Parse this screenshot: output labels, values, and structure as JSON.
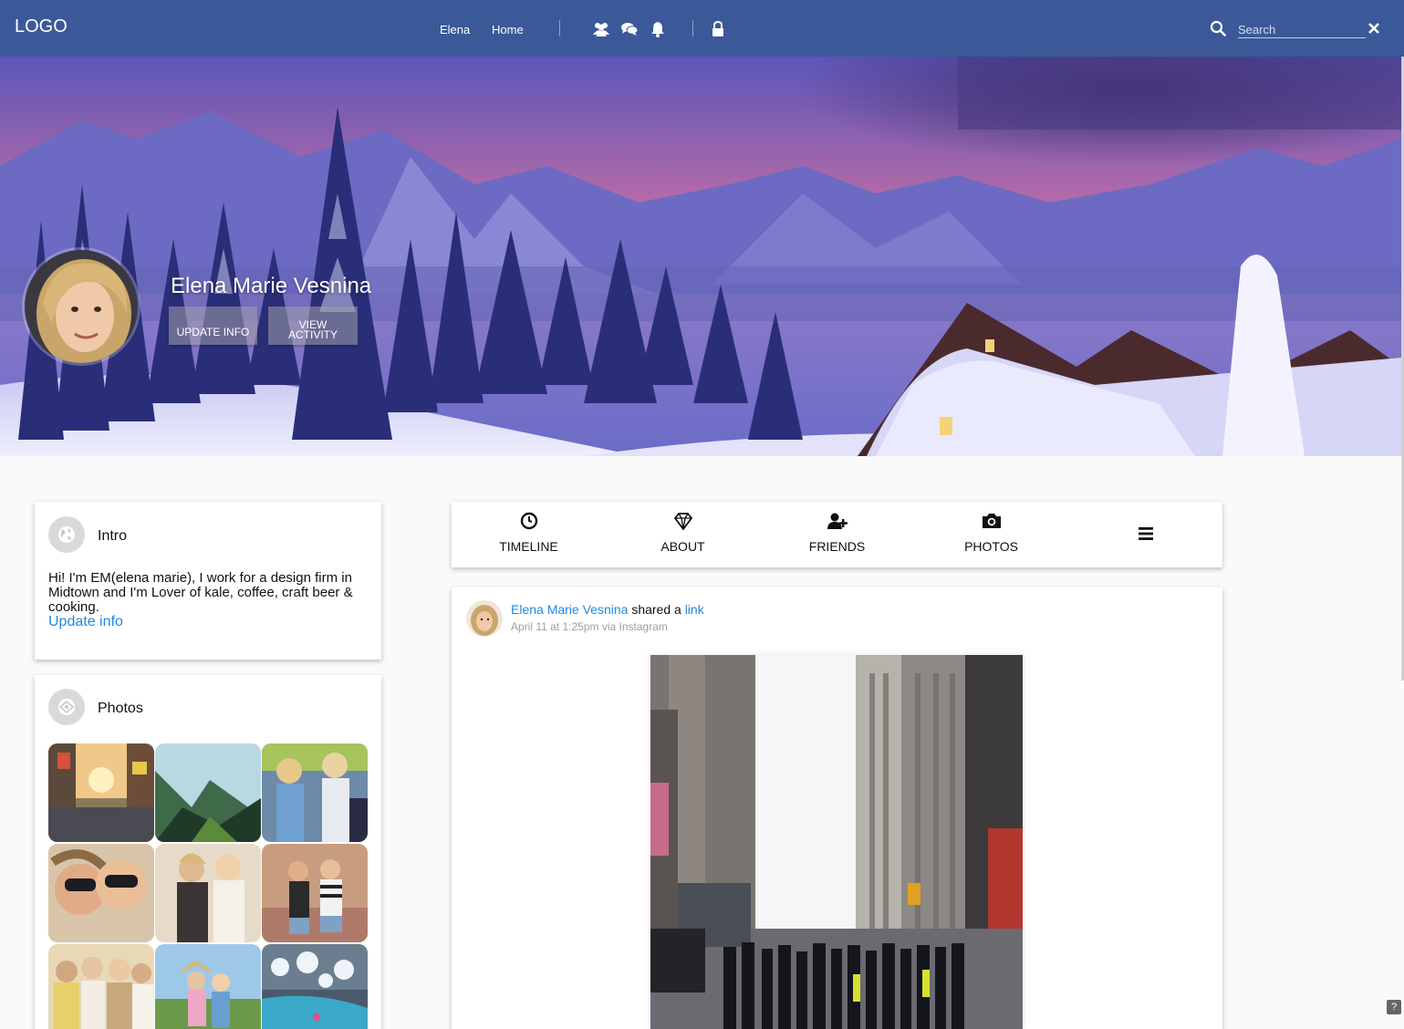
{
  "header": {
    "logo": "LOGO",
    "nav_links": [
      "Elena",
      "Home"
    ],
    "icons": [
      "users-icon",
      "chat-icon",
      "bell-icon",
      "lock-icon"
    ],
    "search_placeholder": "Search",
    "color": "#3b5998"
  },
  "profile": {
    "name": "Elena Marie Vesnina",
    "update_info_button": "UPDATE INFO",
    "view_activity_button_line1": "VIEW",
    "view_activity_button_line2": "ACTIVITY"
  },
  "intro": {
    "title": "Intro",
    "text": "Hi! I'm EM(elena marie), I work for a design firm in Midtown and I'm Lover of kale, coffee, craft beer & cooking.",
    "update_link": "Update info"
  },
  "photos": {
    "title": "Photos",
    "items": [
      "city-street-photo",
      "valley-photo",
      "friends-graffiti-photo",
      "sunglasses-selfie-photo",
      "friends-outdoor-photo",
      "friends-street-photo",
      "group-photo",
      "field-photo",
      "frozen-river-photo"
    ]
  },
  "tabs": [
    {
      "label": "TIMELINE",
      "icon": "clock-icon"
    },
    {
      "label": "ABOUT",
      "icon": "diamond-icon"
    },
    {
      "label": "FRIENDS",
      "icon": "add-friend-icon"
    },
    {
      "label": "PHOTOS",
      "icon": "camera-icon"
    },
    {
      "label": "",
      "icon": "menu-icon"
    }
  ],
  "post": {
    "author": "Elena Marie Vesnina",
    "action": "shared a",
    "object_link": "link",
    "meta": "April 11 at 1:25pm via Instagram"
  },
  "accent_color": "#1e88e5"
}
